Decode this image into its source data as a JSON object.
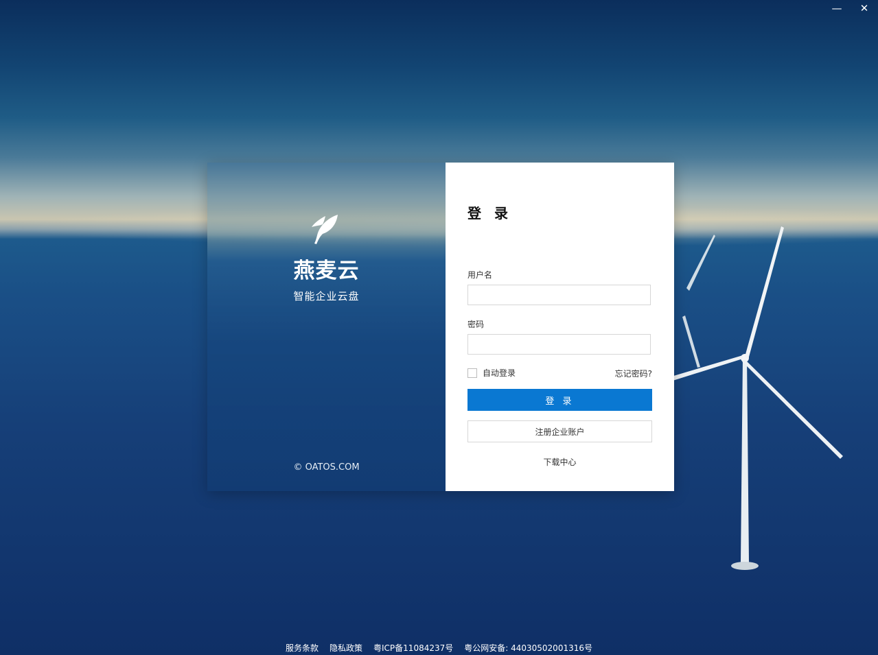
{
  "window": {
    "minimize_label": "—",
    "close_label": "✕"
  },
  "brand": {
    "name": "燕麦云",
    "tagline": "智能企业云盘",
    "copyright": "© OATOS.COM",
    "logo_icon": "leaf-icon"
  },
  "form": {
    "title": "登 录",
    "username_label": "用户名",
    "username_value": "",
    "password_label": "密码",
    "password_value": "",
    "auto_login_label": "自动登录",
    "auto_login_checked": false,
    "forgot_label": "忘记密码?",
    "login_button": "登 录",
    "register_button": "注册企业账户",
    "download_link": "下载中心"
  },
  "footer": {
    "links": [
      "服务条款",
      "隐私政策",
      "粤ICP备11084237号",
      "粤公网安备: 44030502001316号"
    ]
  },
  "colors": {
    "primary": "#0a78d2"
  }
}
